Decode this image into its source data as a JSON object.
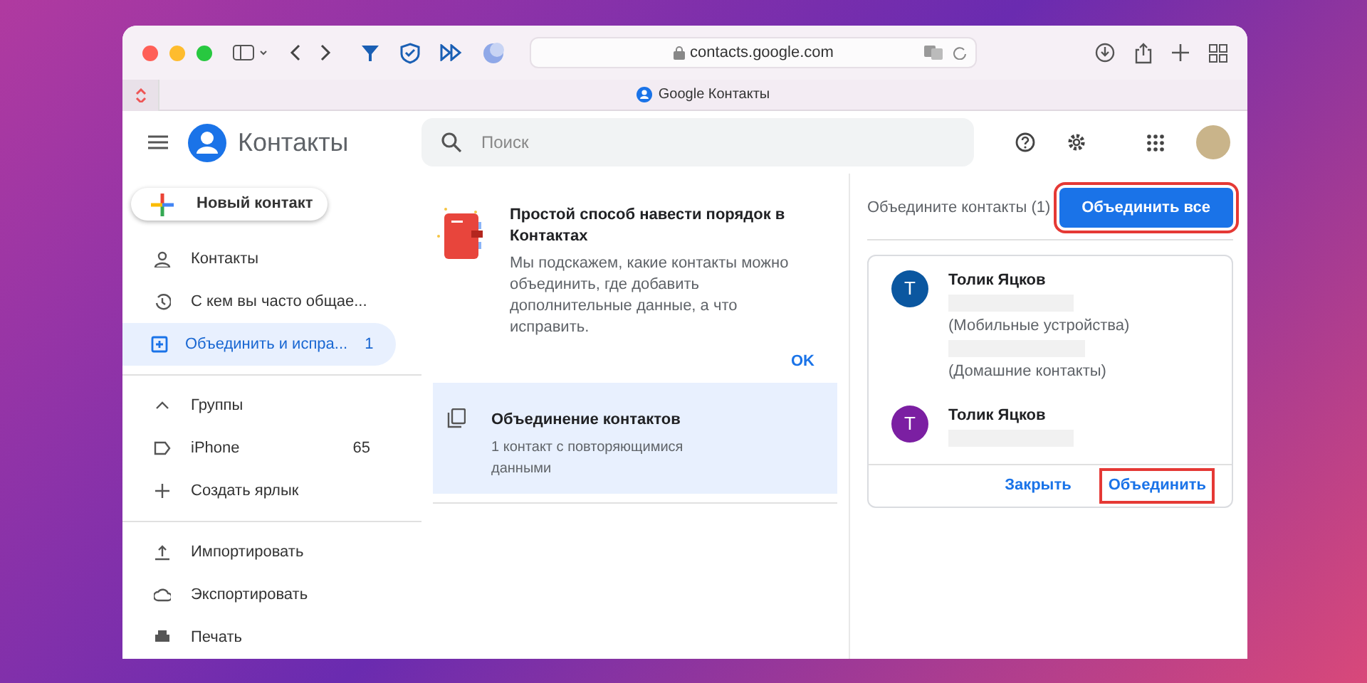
{
  "browser": {
    "url": "contacts.google.com",
    "tab_title": "Google Контакты"
  },
  "app": {
    "title": "Контакты",
    "search": {
      "placeholder": "Поиск"
    }
  },
  "new_contact": "Новый контакт",
  "nav": [
    {
      "label": "Контакты",
      "selected": false
    },
    {
      "label": "С кем вы часто общае...",
      "selected": false
    },
    {
      "label": "Объединить и испра...",
      "count": "1",
      "selected": true
    }
  ],
  "groups": {
    "label": "Группы",
    "expanded": true,
    "items": [
      {
        "label": "iPhone",
        "count": "65"
      }
    ],
    "create": "Создать ярлык"
  },
  "actions": [
    "Импортировать",
    "Экспортировать",
    "Печать"
  ],
  "tip": {
    "title": "Простой способ навести порядок в Контактах",
    "body": "Мы подскажем, какие контакты можно объединить, где добавить дополнительные данные, а что исправить.",
    "ok": "OK"
  },
  "suggestion": {
    "title": "Объединение контактов",
    "subtitle": "1 контакт с повторяющимися данными",
    "selected": true
  },
  "merge_panel": {
    "heading": "Объедините контакты (1)",
    "merge_all": {
      "label": "Объединить все",
      "highlighted": true
    },
    "contacts": [
      {
        "initial": "T",
        "name": "Толик Яцков",
        "color": "#0b57a0",
        "sources": [
          "(Мобильные устройства)",
          "(Домашние контакты)"
        ]
      },
      {
        "initial": "T",
        "name": "Толик Яцков",
        "color": "#7b1fa2"
      }
    ],
    "close": {
      "label": "Закрыть"
    },
    "merge": {
      "label": "Объединить",
      "highlighted": true
    }
  }
}
